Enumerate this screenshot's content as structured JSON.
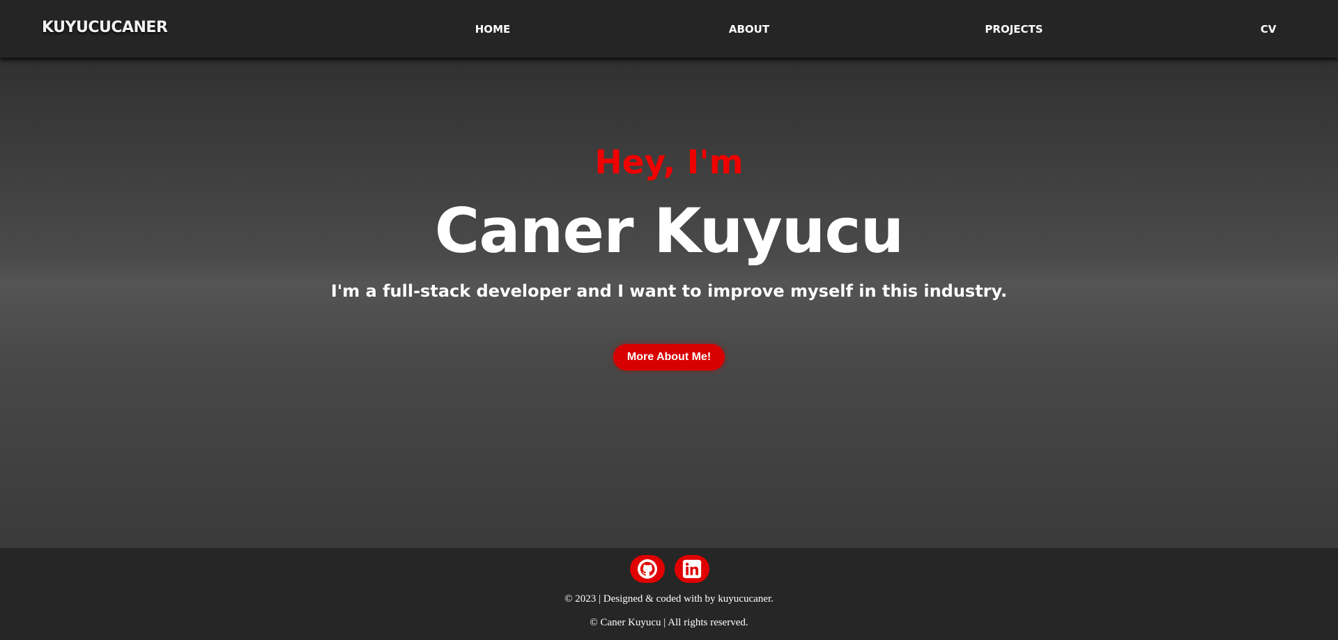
{
  "navbar": {
    "logo": "KUYUCUCANER",
    "links": [
      {
        "label": "HOME"
      },
      {
        "label": "ABOUT"
      },
      {
        "label": "PROJECTS"
      },
      {
        "label": "CV"
      }
    ]
  },
  "hero": {
    "greeting": "Hey, I'm",
    "name": "Caner Kuyucu",
    "tagline": "I'm a full-stack developer and I want to improve myself in this industry.",
    "cta_label": "More About Me!"
  },
  "footer": {
    "social": [
      {
        "icon": "github-icon"
      },
      {
        "icon": "linkedin-icon"
      }
    ],
    "credit": "© 2023 | Designed & coded with by kuyucucaner.",
    "copyright": "© Caner Kuyucu | All rights reserved."
  },
  "colors": {
    "accent": "#e00000",
    "navbar_bg": "#252525",
    "footer_bg": "#262626",
    "text": "#ffffff"
  }
}
